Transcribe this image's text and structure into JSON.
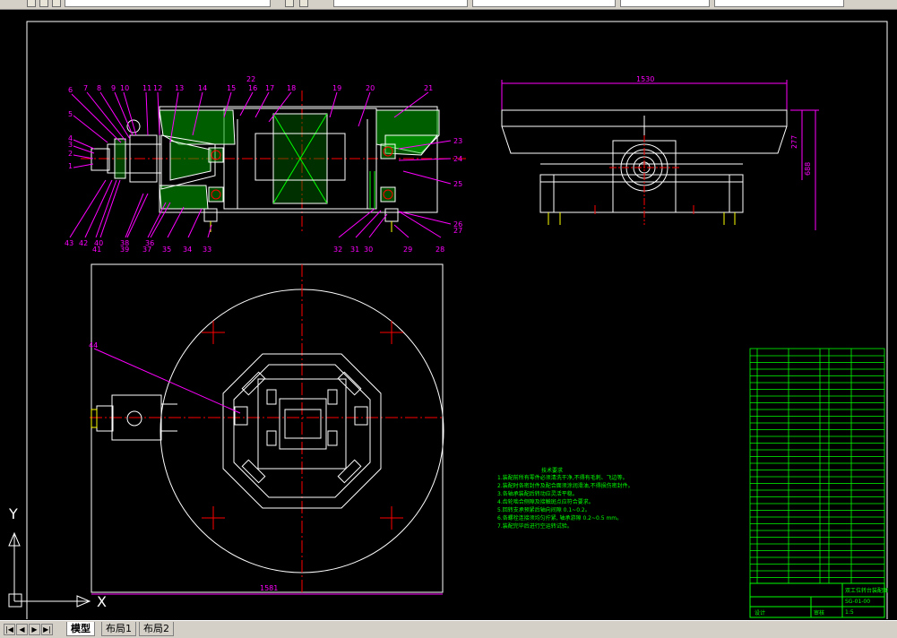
{
  "toolbar": {
    "layer_field": "",
    "fields": [
      "",
      "",
      "",
      ""
    ]
  },
  "drawing": {
    "dimensions": {
      "width_top": "1530",
      "height_side_1": "277",
      "height_side_2": "688",
      "width_plan": "1581"
    },
    "balloons_top": [
      "6",
      "7",
      "8",
      "9",
      "10",
      "11",
      "12",
      "13",
      "14",
      "15",
      "16",
      "17",
      "18",
      "19",
      "20",
      "21",
      "22"
    ],
    "balloons_left": [
      "5",
      "4",
      "3",
      "2",
      "1"
    ],
    "balloons_bottom": [
      "43",
      "42",
      "41",
      "40",
      "39",
      "38",
      "37",
      "36",
      "35",
      "34",
      "33",
      "32",
      "31",
      "30",
      "29",
      "28"
    ],
    "balloons_right": [
      "23",
      "24",
      "25",
      "26",
      "27"
    ],
    "plan_balloon": "44",
    "tech_title": "技术要求",
    "tech_notes": [
      "1.装配前所有零件必须清洗干净,不得有毛刺、飞边等。",
      "2.装配时各密封件及配合面须涂润滑油,不得损伤密封件。",
      "3.各轴承装配后转动应灵活平稳。",
      "4.齿轮啮合侧隙及接触斑点应符合要求。",
      "5.回转支承预紧后轴向间隙 0.1~0.2。",
      "6.各螺栓连接须均匀拧紧, 轴承游隙 0.2~0.5 mm。",
      "7.装配完毕后进行空运转试验。"
    ],
    "title_block": {
      "project": "双工位转台装配图",
      "drawing_no": "SG-01-00",
      "scale": "1:5",
      "drawn_label": "设计",
      "check_label": "审核"
    }
  },
  "ucs": {
    "y_label": "Y",
    "x_label": "X"
  },
  "tabs": [
    "模型",
    "布局1",
    "布局2"
  ],
  "colors": {
    "bg": "#000000",
    "white": "#ffffff",
    "magenta": "#ff00ff",
    "red": "#ff0000",
    "green": "#00ff00"
  }
}
